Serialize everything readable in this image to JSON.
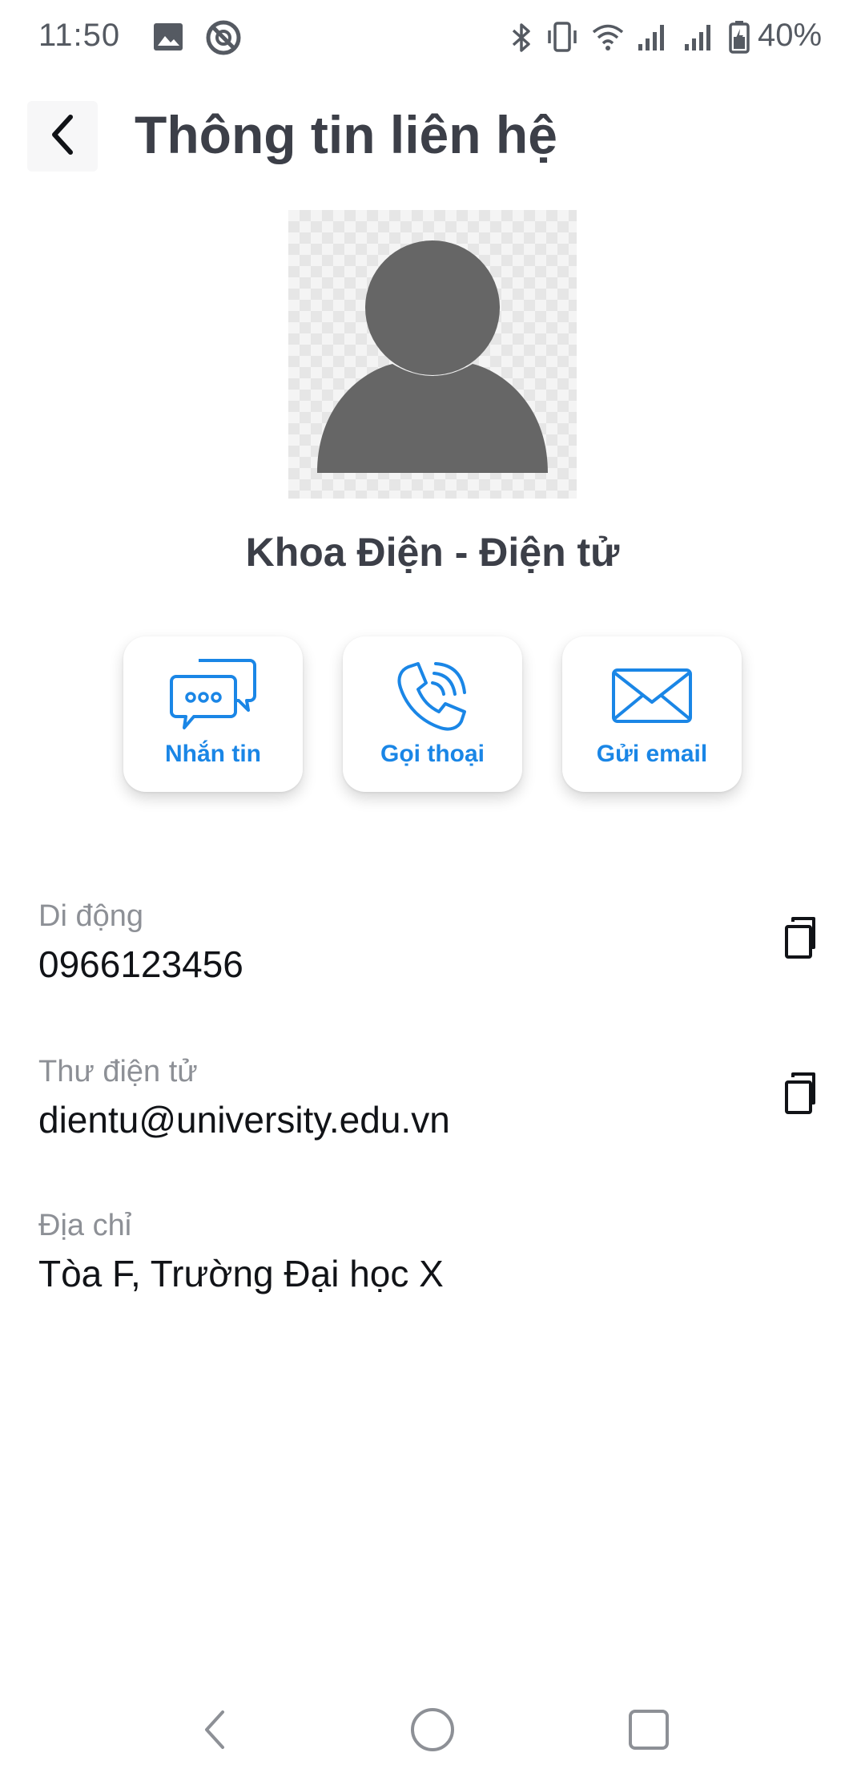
{
  "status_bar": {
    "time": "11:50",
    "battery": "40%",
    "icons": [
      "image-icon",
      "data-saver-icon",
      "bluetooth-icon",
      "vibrate-icon",
      "wifi-icon",
      "signal-icon",
      "signal-icon",
      "battery-icon"
    ]
  },
  "header": {
    "title": "Thông tin liên hệ",
    "back_icon": "chevron-left-icon"
  },
  "contact": {
    "name": "Khoa Điện - Điện tử",
    "avatar_icon": "person-placeholder-icon"
  },
  "actions": [
    {
      "label": "Nhắn tin",
      "icon": "chat-bubbles-icon"
    },
    {
      "label": "Gọi thoại",
      "icon": "phone-call-icon"
    },
    {
      "label": "Gửi email",
      "icon": "envelope-icon"
    }
  ],
  "details": [
    {
      "label": "Di động",
      "value": "0966123456",
      "copyable": true
    },
    {
      "label": "Thư điện tử",
      "value": "dientu@university.edu.vn",
      "copyable": true
    },
    {
      "label": "Địa chỉ",
      "value": "Tòa F, Trường Đại học X",
      "copyable": false
    }
  ],
  "colors": {
    "accent": "#1a86e6",
    "title": "#3c3f48",
    "label": "#8d9096",
    "value": "#111317",
    "avatar": "#666666"
  },
  "nav_bar": {
    "icons": [
      "nav-back-icon",
      "nav-home-icon",
      "nav-recents-icon"
    ]
  }
}
